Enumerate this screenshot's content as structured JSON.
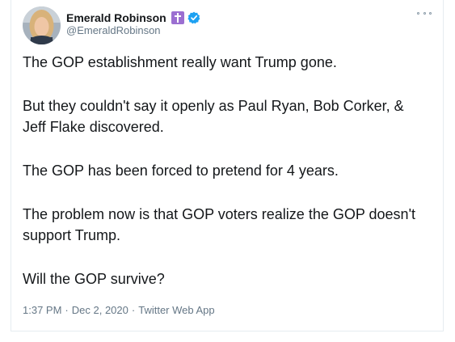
{
  "author": {
    "display_name": "Emerald Robinson",
    "handle": "@EmeraldRobinson",
    "badge_cross": "cross-icon",
    "badge_verified": "verified-icon"
  },
  "tweet": {
    "paragraphs": [
      "The GOP establishment really want Trump gone.",
      "But they couldn't say it openly as Paul Ryan, Bob Corker, & Jeff Flake discovered.",
      "The GOP has been forced to pretend for 4 years.",
      "The problem now is that GOP voters realize the GOP doesn't support Trump.",
      "Will the GOP survive?"
    ]
  },
  "meta": {
    "time": "1:37 PM",
    "separator": "·",
    "date": "Dec 2, 2020",
    "source": "Twitter Web App"
  },
  "colors": {
    "text": "#14171a",
    "secondary": "#657786",
    "verified": "#1da1f2",
    "cross_badge": "#9b6fd1"
  }
}
